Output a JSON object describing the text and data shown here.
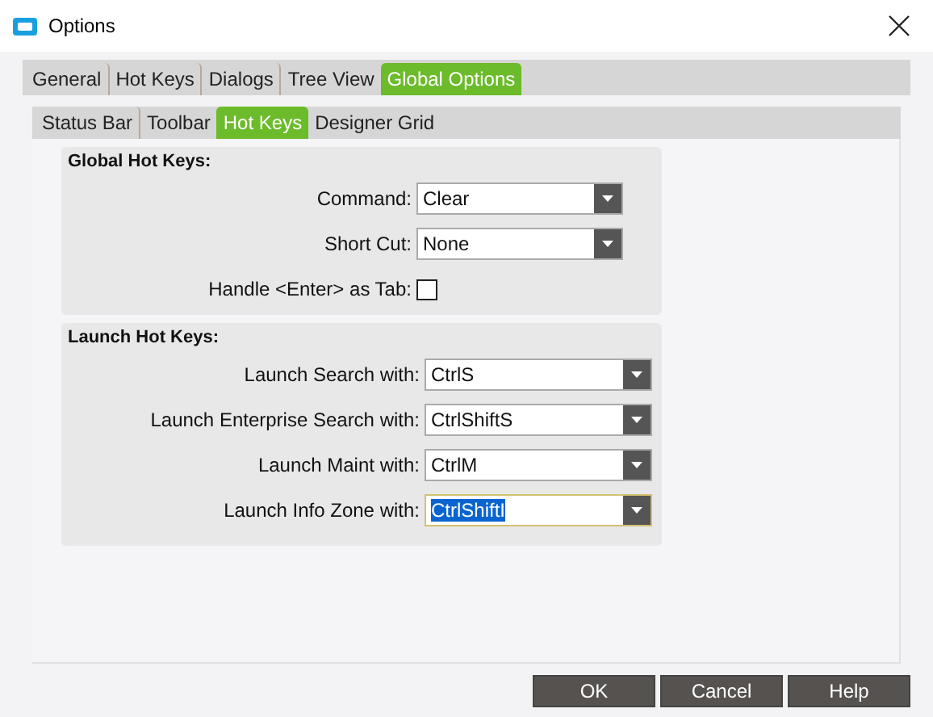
{
  "window": {
    "title": "Options"
  },
  "tabs": [
    {
      "label": "General",
      "selected": false
    },
    {
      "label": "Hot Keys",
      "selected": false
    },
    {
      "label": "Dialogs",
      "selected": false
    },
    {
      "label": "Tree View",
      "selected": false
    },
    {
      "label": "Global Options",
      "selected": true
    }
  ],
  "subtabs": [
    {
      "label": "Status Bar",
      "selected": false
    },
    {
      "label": "Toolbar",
      "selected": false
    },
    {
      "label": "Hot Keys",
      "selected": true
    },
    {
      "label": "Designer Grid",
      "selected": false
    }
  ],
  "groups": [
    {
      "title": "Global Hot Keys:",
      "rows": [
        {
          "kind": "dropdown",
          "label": "Command:",
          "value": "Clear",
          "focused": false
        },
        {
          "kind": "dropdown",
          "label": "Short Cut:",
          "value": "None",
          "focused": false
        },
        {
          "kind": "checkbox",
          "label": "Handle <Enter> as Tab:",
          "checked": false
        }
      ]
    },
    {
      "title": "Launch Hot Keys:",
      "rows": [
        {
          "kind": "dropdown",
          "label": "Launch Search with:",
          "value": "CtrlS",
          "focused": false
        },
        {
          "kind": "dropdown",
          "label": "Launch Enterprise Search with:",
          "value": "CtrlShiftS",
          "focused": false
        },
        {
          "kind": "dropdown",
          "label": "Launch Maint with:",
          "value": "CtrlM",
          "focused": false
        },
        {
          "kind": "dropdown",
          "label": "Launch Info Zone with:",
          "value": "CtrlShiftI",
          "focused": true
        }
      ]
    }
  ],
  "buttons": [
    "OK",
    "Cancel",
    "Help"
  ]
}
